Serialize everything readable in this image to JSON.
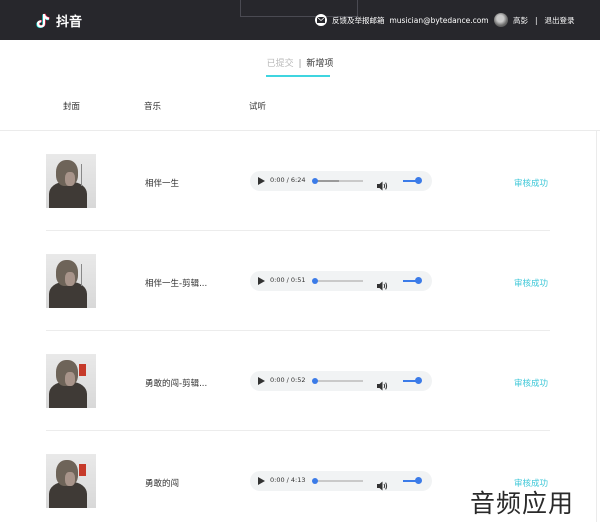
{
  "header": {
    "logo_text": "抖音",
    "feedback_label": "反馈及举报邮箱",
    "feedback_email": "musician@bytedance.com",
    "username": "高彭",
    "separator": "|",
    "logout": "退出登录"
  },
  "tabs": {
    "submitted": "已提交",
    "divider": "|",
    "new_item": "新增项"
  },
  "columns": {
    "cover": "封面",
    "music": "音乐",
    "listen": "试听"
  },
  "rows": [
    {
      "title": "相伴一生",
      "time": "0:00 / 6:24",
      "status": "审核成功",
      "progress": 0
    },
    {
      "title": "相伴一生-剪辑...",
      "time": "0:00 / 0:51",
      "status": "审核成功",
      "progress": 0
    },
    {
      "title": "勇敢的闯-剪辑...",
      "time": "0:00 / 0:52",
      "status": "审核成功",
      "progress": 0
    },
    {
      "title": "勇敢的闯",
      "time": "0:00 / 4:13",
      "status": "审核成功",
      "progress": 0
    }
  ],
  "watermark": "音频应用",
  "colors": {
    "header_bg": "#27272c",
    "accent": "#3fd5e0",
    "status": "#3fc8d8",
    "slider": "#3b7be8"
  }
}
